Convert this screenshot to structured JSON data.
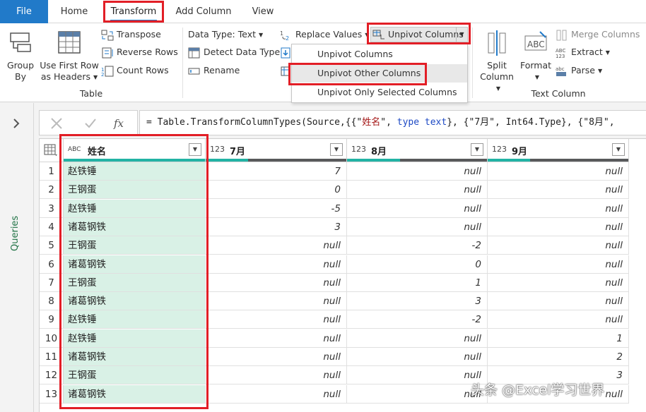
{
  "tabs": {
    "file": "File",
    "home": "Home",
    "transform": "Transform",
    "add_column": "Add Column",
    "view": "View"
  },
  "ribbon": {
    "group_by": [
      "Group",
      "By"
    ],
    "use_first_row": [
      "Use First Row",
      "as Headers"
    ],
    "transpose": "Transpose",
    "reverse_rows": "Reverse Rows",
    "count_rows": "Count Rows",
    "table_group": "Table",
    "data_type": "Data Type: Text",
    "detect_data_type": "Detect Data Type",
    "rename": "Rename",
    "replace_values": "Replace Values",
    "unpivot_columns": "Unpivot Columns",
    "split_column": [
      "Split",
      "Column"
    ],
    "format": "Format",
    "merge_columns": "Merge Columns",
    "extract": "Extract",
    "parse": "Parse",
    "text_column_group": "Text Column"
  },
  "dropdown": {
    "items": [
      "Unpivot Columns",
      "Unpivot Other Columns",
      "Unpivot Only Selected Columns"
    ]
  },
  "left_panel": {
    "label": "Queries"
  },
  "formula": {
    "prefix": "= Table.TransformColumnTypes(Source,{{\"",
    "c1": "姓名",
    "mid1": "\", ",
    "t1": "type",
    "t1b": " text",
    "mid2": "}, {\"",
    "c2": "7月",
    "mid3": "\", Int64.Type}, {\"",
    "c3": "8月",
    "tail": "\","
  },
  "grid": {
    "columns": [
      {
        "type": "ABC",
        "name": "姓名"
      },
      {
        "type": "123",
        "name": "7月"
      },
      {
        "type": "123",
        "name": "8月"
      },
      {
        "type": "123",
        "name": "9月"
      }
    ],
    "rows": [
      [
        "1",
        "赵铁锤",
        "7",
        "null",
        "null"
      ],
      [
        "2",
        "王钢蛋",
        "0",
        "null",
        "null"
      ],
      [
        "3",
        "赵铁锤",
        "-5",
        "null",
        "null"
      ],
      [
        "4",
        "诸葛钢铁",
        "3",
        "null",
        "null"
      ],
      [
        "5",
        "王钢蛋",
        "null",
        "-2",
        "null"
      ],
      [
        "6",
        "诸葛钢铁",
        "null",
        "0",
        "null"
      ],
      [
        "7",
        "王钢蛋",
        "null",
        "1",
        "null"
      ],
      [
        "8",
        "诸葛钢铁",
        "null",
        "3",
        "null"
      ],
      [
        "9",
        "赵铁锤",
        "null",
        "-2",
        "null"
      ],
      [
        "10",
        "赵铁锤",
        "null",
        "null",
        "1"
      ],
      [
        "11",
        "诸葛钢铁",
        "null",
        "null",
        "2"
      ],
      [
        "12",
        "王钢蛋",
        "null",
        "null",
        "3"
      ],
      [
        "13",
        "诸葛钢铁",
        "null",
        "null",
        "null"
      ]
    ]
  },
  "watermark": "头条 @Excel学习世界",
  "colors": {
    "accent": "#217ac9",
    "highlight": "#e21e26",
    "selected_column": "#d9f1e6",
    "quality_ok": "#22b3a4"
  }
}
